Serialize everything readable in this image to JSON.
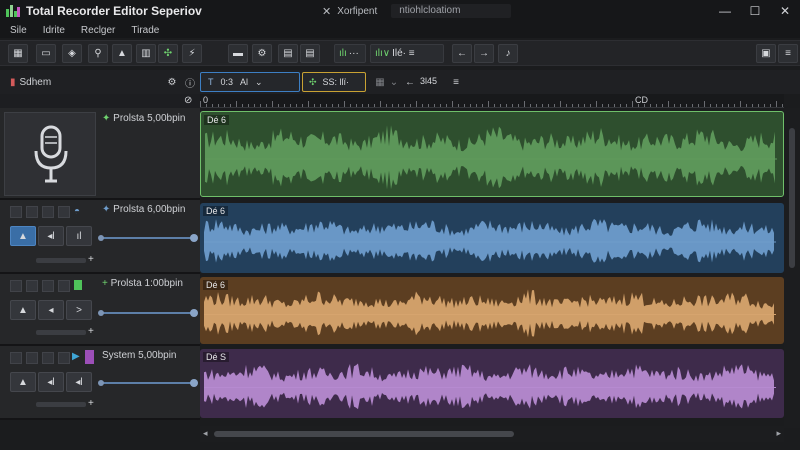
{
  "window": {
    "title": "Total Recorder Editor Seperiov",
    "center_label": "Xorfipent",
    "center_field": "ntiohlcloatiom",
    "controls": [
      "—",
      "☐",
      "✕"
    ]
  },
  "menu": [
    "Sile",
    "Idrite",
    "Reclger",
    "Tirade"
  ],
  "toolbar": {
    "icons": [
      "grid-icon",
      "select-icon",
      "loop-icon",
      "zoom-icon",
      "warning-icon",
      "chart-icon",
      "snap-icon",
      "brush-icon",
      "layout-icon",
      "gear-icon",
      "panel-icon",
      "panel2-icon",
      "save-icon",
      "menu-icon"
    ],
    "group1": "···",
    "group2_left": "···",
    "group2_mid": "∨",
    "group2_right": "Ilé· ≡",
    "nav_back": "←",
    "nav_fwd": "→",
    "tuner": "♪"
  },
  "toolbar2": {
    "session_label": "Sdhem",
    "time_value": "0:3",
    "time_unit": "Al",
    "tempo_value": "SS: llï·",
    "rate_value": "3l45",
    "menu_icon": "≡"
  },
  "ruler": {
    "start": "0",
    "mid": "CD"
  },
  "tracks": [
    {
      "name": "Prolsta  5,00bpin",
      "clip_label": "Dé 6",
      "color": "#5f9a5c",
      "bg": "#2e4f2e",
      "selected": true,
      "type": "microphone"
    },
    {
      "name": "Prolsta  6,00bpin",
      "clip_label": "Dé 6",
      "color": "#6e9ccb",
      "bg": "#23405c",
      "selected": false,
      "type": "audio"
    },
    {
      "name": "Prolsta  1:00bpin",
      "clip_label": "Dé 6",
      "color": "#d6a46e",
      "bg": "#5c3e21",
      "selected": false,
      "type": "audio"
    },
    {
      "name": "System  5,00bpin",
      "clip_label": "Dé S",
      "color": "#b68ad0",
      "bg": "#3e2b4b",
      "selected": false,
      "type": "audio"
    }
  ]
}
